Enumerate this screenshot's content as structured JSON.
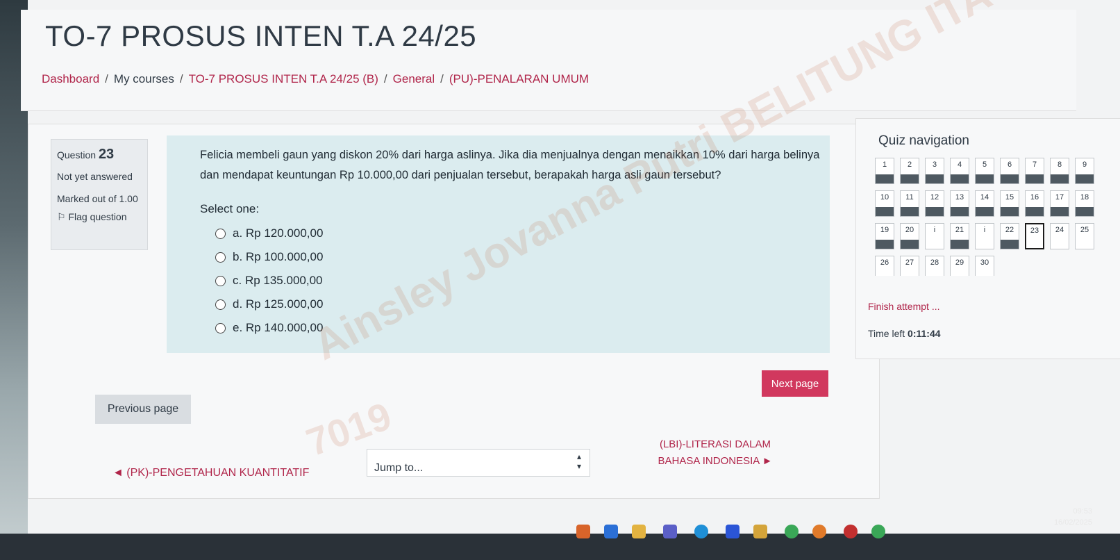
{
  "course": {
    "title": "TO-7 PROSUS INTEN T.A 24/25",
    "breadcrumb": [
      "Dashboard",
      "My courses",
      "TO-7 PROSUS INTEN T.A 24/25 (B)",
      "General",
      "(PU)-PENALARAN UMUM"
    ]
  },
  "question": {
    "label": "Question",
    "number": "23",
    "state": "Not yet answered",
    "mark": "Marked out of 1.00",
    "flag": "Flag question",
    "text": "Felicia membeli gaun yang diskon 20% dari harga aslinya. Jika dia menjualnya dengan menaikkan 10% dari harga belinya dan mendapat keuntungan Rp 10.000,00 dari penjualan tersebut, berapakah harga asli gaun tersebut?",
    "prompt": "Select one:",
    "options": [
      "a. Rp 120.000,00",
      "b. Rp 100.000,00",
      "c. Rp 135.000,00",
      "d. Rp 125.000,00",
      "e. Rp 140.000,00"
    ]
  },
  "watermark": {
    "line1": "Ainsley Jovanna Putri BELITUNG ITA",
    "line2": "7019"
  },
  "buttons": {
    "next": "Next page",
    "prev": "Previous page"
  },
  "activity_nav": {
    "prev": "◄ (PK)-PENGETAHUAN KUANTITATIF",
    "jump": "Jump to...",
    "next": "(LBI)-LITERASI DALAM BAHASA INDONESIA ►"
  },
  "quiz_nav": {
    "title": "Quiz navigation",
    "rows": [
      [
        "1",
        "2",
        "3",
        "4",
        "5",
        "6",
        "7",
        "8",
        "9"
      ],
      [
        "10",
        "11",
        "12",
        "13",
        "14",
        "15",
        "16",
        "17",
        "18"
      ],
      [
        "19",
        "20",
        "i",
        "21",
        "i",
        "22",
        "23",
        "24",
        "25"
      ],
      [
        "26",
        "27",
        "28",
        "29",
        "30"
      ]
    ],
    "answered_rows": [
      0,
      1
    ],
    "current": "23",
    "finish": "Finish attempt ...",
    "time_label": "Time left",
    "time_value": "0:11:44"
  },
  "taskbar": {
    "time": "09:53",
    "date": "16/02/2025"
  }
}
